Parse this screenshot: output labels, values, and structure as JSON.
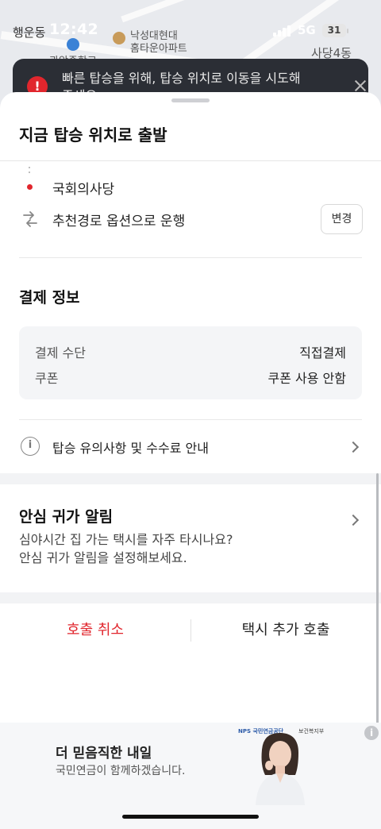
{
  "status_bar": {
    "time": "12:42",
    "network": "5G",
    "battery": "31"
  },
  "map": {
    "labels": [
      "행운동",
      "낙성대현대",
      "홈타운아파트",
      "사당4동",
      "관악중학교"
    ]
  },
  "toast": {
    "message": "빠른 탑승을 위해, 탑승 위치로 이동을 시도해 주세요."
  },
  "sheet": {
    "title": "지금 탑승 위치로 출발"
  },
  "route": {
    "destination": "국회의사당",
    "option_text": "추천경로 옵션으로 운행",
    "change_label": "변경"
  },
  "payment": {
    "title": "결제 정보",
    "rows": [
      {
        "label": "결제 수단",
        "value": "직접결제"
      },
      {
        "label": "쿠폰",
        "value": "쿠폰 사용 안함"
      }
    ]
  },
  "notice": {
    "text": "탑승 유의사항 및 수수료 안내"
  },
  "safe_alert": {
    "title": "안심 귀가 알림",
    "desc_line1": "심야시간 집 가는 택시를 자주 타시나요?",
    "desc_line2": "안심 귀가 알림을 설정해보세요."
  },
  "actions": {
    "cancel_label": "호출 취소",
    "add_call_label": "택시 추가 호출"
  },
  "ad": {
    "title": "더 믿음직한 내일",
    "subtitle": "국민연금이 함께하겠습니다.",
    "logo_left": "NPS 국민연금공단",
    "logo_right": "보건복지부"
  },
  "colors": {
    "accent_red": "#e1262d",
    "toast_bg": "#2b2e35"
  }
}
